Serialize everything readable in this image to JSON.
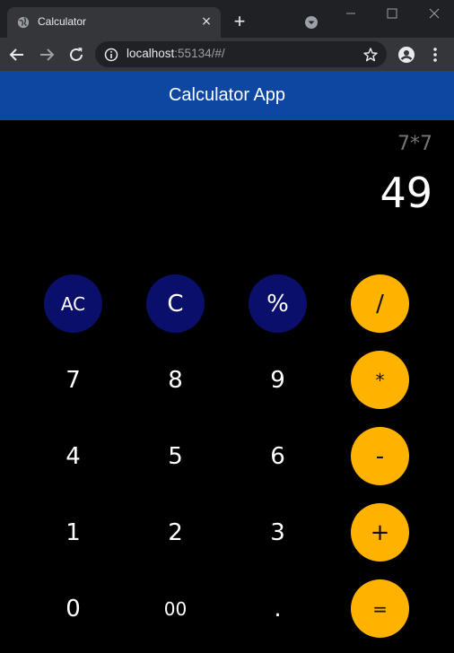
{
  "browser": {
    "tab_title": "Calculator",
    "tab_close": "×",
    "new_tab": "+",
    "url_host": "localhost",
    "url_rest": ":55134/#/"
  },
  "app": {
    "title": "Calculator App",
    "expression": "7*7",
    "result": "49"
  },
  "keys": {
    "ac": "AC",
    "c": "C",
    "percent": "%",
    "divide": "/",
    "seven": "7",
    "eight": "8",
    "nine": "9",
    "multiply": "*",
    "four": "4",
    "five": "5",
    "six": "6",
    "minus": "-",
    "one": "1",
    "two": "2",
    "three": "3",
    "plus": "+",
    "zero": "0",
    "double_zero": "00",
    "dot": ".",
    "equals": "="
  },
  "colors": {
    "appbar": "#0d47a1",
    "function_key": "#0a0f6b",
    "operator_key": "#ffb300",
    "background": "#000000"
  },
  "icons": [
    "globe-icon",
    "close-icon",
    "plus-icon",
    "tab-search-icon",
    "minimize-icon",
    "maximize-icon",
    "close-window-icon",
    "back-arrow-icon",
    "forward-arrow-icon",
    "reload-icon",
    "info-icon",
    "star-icon",
    "profile-icon",
    "kebab-menu-icon"
  ]
}
